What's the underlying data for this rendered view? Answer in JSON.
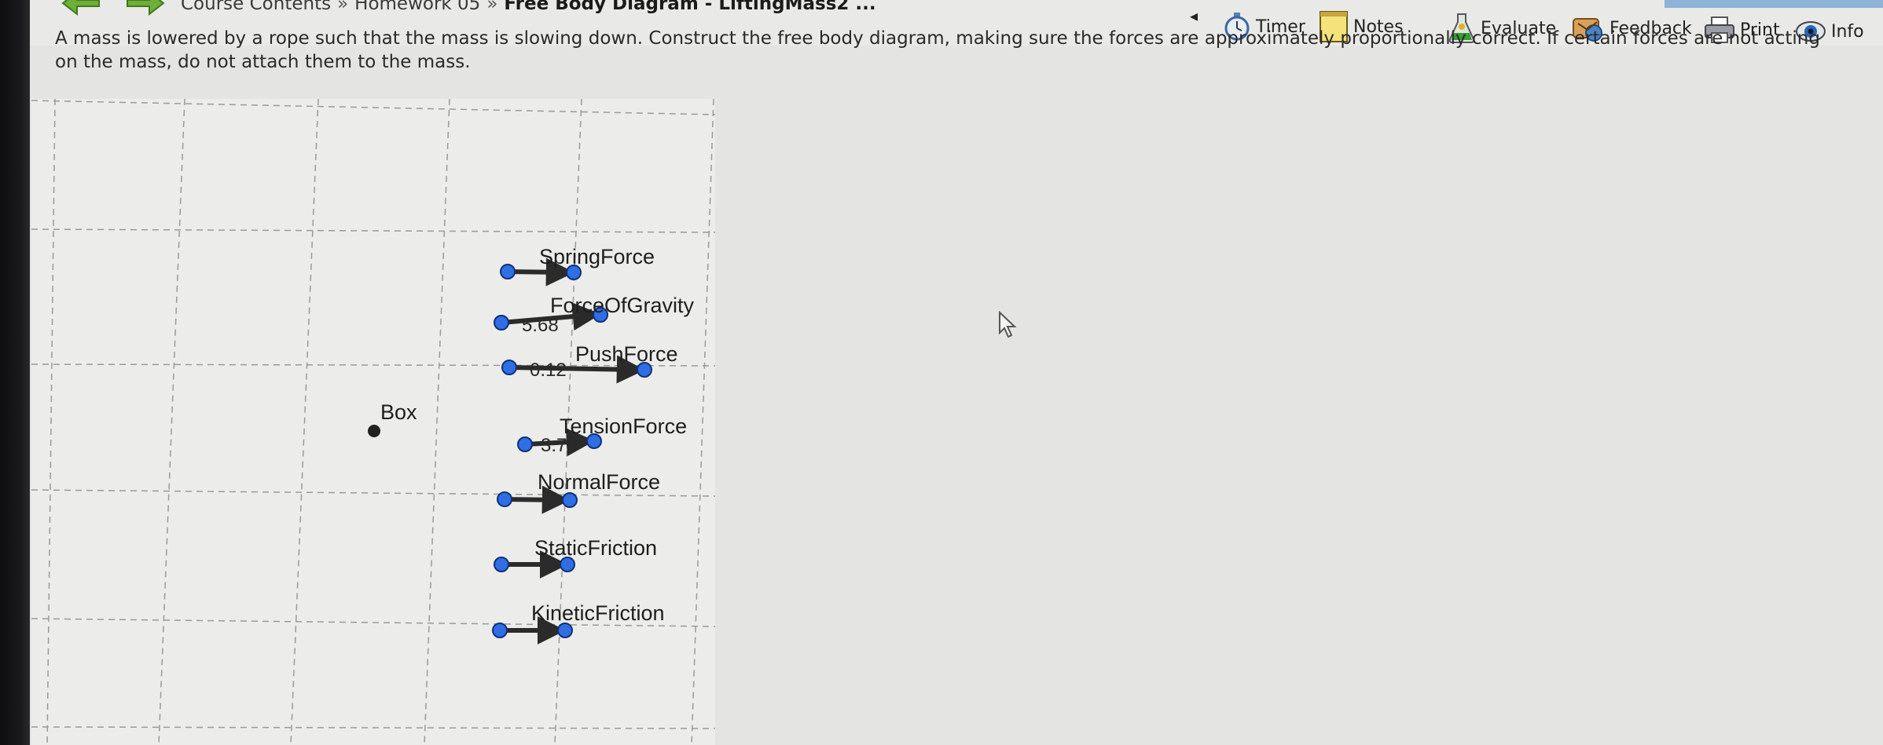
{
  "breadcrumb": {
    "course_contents": "Course Contents",
    "separator": "»",
    "homework": "Homework 05",
    "current": "Free Body Diagram - LiftingMass2 ..."
  },
  "toolbar": {
    "collapse_glyph": "◂",
    "timer": "Timer",
    "notes": "Notes",
    "evaluate": "Evaluate",
    "feedback": "Feedback",
    "print": "Print",
    "info": "Info"
  },
  "instructions": {
    "text": "A mass is lowered by a rope such that the mass is slowing down. Construct the free body diagram, making sure the forces are approximately proportionally correct. If certain forces are not acting on the mass, do not attach them to the mass."
  },
  "diagram": {
    "body_label": "Box",
    "forces": [
      {
        "label": "SpringForce",
        "value": ""
      },
      {
        "label": "ForceOfGravity",
        "value": "5.68"
      },
      {
        "label": "PushForce",
        "value": "0.12"
      },
      {
        "label": "TensionForce",
        "value": "3.78"
      },
      {
        "label": "NormalForce",
        "value": ""
      },
      {
        "label": "StaticFriction",
        "value": ""
      },
      {
        "label": "KineticFriction",
        "value": ""
      }
    ],
    "colors": {
      "handle_fill": "#2f6fe3",
      "handle_stroke": "#10307a",
      "arrow": "#2b2b2b",
      "grid": "#9a9a9a",
      "body": "#222222"
    }
  },
  "icons": {
    "back": "back-arrow-icon",
    "forward": "forward-arrow-icon",
    "timer": "stopwatch-icon",
    "notes": "notepad-icon",
    "evaluate": "flask-icon",
    "feedback": "feedback-icon",
    "print": "printer-icon",
    "info": "eye-icon",
    "cursor": "mouse-pointer-icon"
  }
}
